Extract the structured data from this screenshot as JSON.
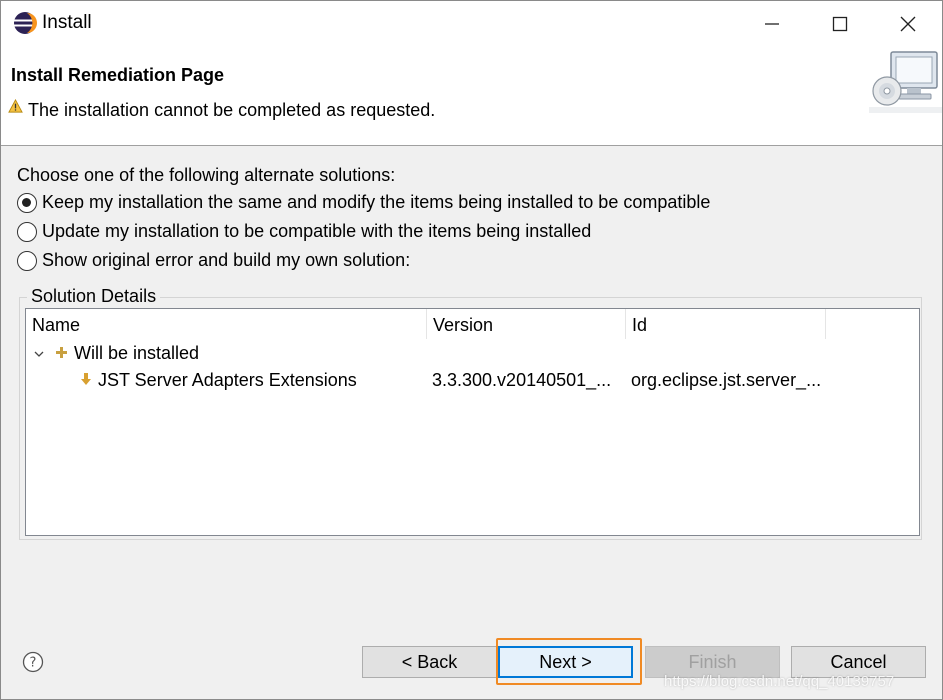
{
  "window": {
    "title": "Install",
    "controls": {
      "minimize": "minimize",
      "maximize": "maximize",
      "close": "close"
    }
  },
  "banner": {
    "title": "Install Remediation Page",
    "message": "The installation cannot be completed as requested.",
    "message_icon": "warning-icon",
    "image": "install-wizard-image"
  },
  "options": {
    "prompt": "Choose one of the following alternate solutions:",
    "items": [
      {
        "label": "Keep my installation the same and modify the items being installed to be compatible",
        "selected": true
      },
      {
        "label": "Update my installation to be compatible with the items being installed",
        "selected": false
      },
      {
        "label": "Show original error and build my own solution:",
        "selected": false
      }
    ]
  },
  "details": {
    "group_label": "Solution Details",
    "columns": [
      "Name",
      "Version",
      "Id"
    ],
    "rows": [
      {
        "name": "Will be installed",
        "version": "",
        "id": "",
        "icon": "plus-icon",
        "expanded": true
      },
      {
        "name": "JST Server Adapters Extensions",
        "version": "3.3.300.v20140501_...",
        "id": "org.eclipse.jst.server_...",
        "icon": "install-arrow-icon"
      }
    ]
  },
  "buttons": {
    "back": "< Back",
    "next": "Next >",
    "finish": "Finish",
    "cancel": "Cancel"
  },
  "colors": {
    "highlight_border": "#f08a24",
    "focus_border": "#0078d7"
  },
  "watermark": "https://blog.csdn.net/qq_40139757"
}
